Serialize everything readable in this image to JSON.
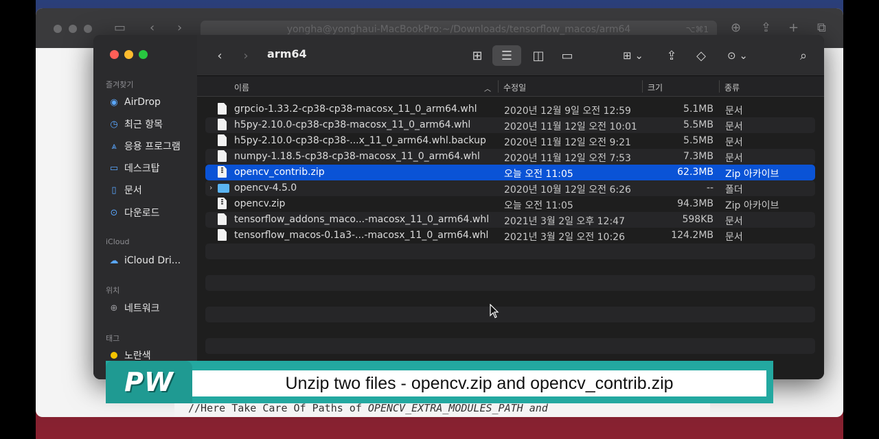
{
  "browser": {
    "url": "yongha@yonghaui-MacBookPro:~/Downloads/tensorflow_macos/arm64",
    "shortcut": "⌥⌘1"
  },
  "finder": {
    "title": "arm64",
    "sidebar": {
      "sections": [
        {
          "label": "즐겨찾기",
          "items": [
            {
              "label": "AirDrop",
              "icon": "airdrop-icon"
            },
            {
              "label": "최근 항목",
              "icon": "clock-icon"
            },
            {
              "label": "응용 프로그램",
              "icon": "applications-icon"
            },
            {
              "label": "데스크탑",
              "icon": "desktop-icon"
            },
            {
              "label": "문서",
              "icon": "document-icon"
            },
            {
              "label": "다운로드",
              "icon": "download-icon"
            }
          ]
        },
        {
          "label": "iCloud",
          "items": [
            {
              "label": "iCloud Dri...",
              "icon": "cloud-icon"
            }
          ]
        },
        {
          "label": "위치",
          "items": [
            {
              "label": "네트워크",
              "icon": "globe-icon"
            }
          ]
        },
        {
          "label": "태그",
          "items": [
            {
              "label": "노란색",
              "icon": "yellow-tag-icon"
            }
          ]
        }
      ]
    },
    "columns": {
      "name": "이름",
      "date": "수정일",
      "size": "크기",
      "kind": "종류"
    },
    "files": [
      {
        "name": "grpcio-1.33.2-cp38-cp38-macosx_11_0_arm64.whl",
        "date": "2020년 12월 9일 오전 12:59",
        "size": "5.1MB",
        "kind": "문서",
        "type": "doc"
      },
      {
        "name": "h5py-2.10.0-cp38-cp38-macosx_11_0_arm64.whl",
        "date": "2020년 11월 12일 오전 10:01",
        "size": "5.5MB",
        "kind": "문서",
        "type": "doc"
      },
      {
        "name": "h5py-2.10.0-cp38-cp38-...x_11_0_arm64.whl.backup",
        "date": "2020년 11월 12일 오전 9:21",
        "size": "5.5MB",
        "kind": "문서",
        "type": "doc"
      },
      {
        "name": "numpy-1.18.5-cp38-cp38-macosx_11_0_arm64.whl",
        "date": "2020년 11월 12일 오전 7:53",
        "size": "7.3MB",
        "kind": "문서",
        "type": "doc"
      },
      {
        "name": "opencv_contrib.zip",
        "date": "오늘 오전 11:05",
        "size": "62.3MB",
        "kind": "Zip 아카이브",
        "type": "zip",
        "selected": true
      },
      {
        "name": "opencv-4.5.0",
        "date": "2020년 10월 12일 오전 6:26",
        "size": "--",
        "kind": "폴더",
        "type": "folder"
      },
      {
        "name": "opencv.zip",
        "date": "오늘 오전 11:05",
        "size": "94.3MB",
        "kind": "Zip 아카이브",
        "type": "zip"
      },
      {
        "name": "tensorflow_addons_maco...-macosx_11_0_arm64.whl",
        "date": "2021년 3월 2일 오후 12:47",
        "size": "598KB",
        "kind": "문서",
        "type": "doc"
      },
      {
        "name": "tensorflow_macos-0.1a3-...-macosx_11_0_arm64.whl",
        "date": "2021년 3월 2일 오전 10:26",
        "size": "124.2MB",
        "kind": "문서",
        "type": "doc"
      }
    ]
  },
  "overlay": {
    "logo": "PW",
    "caption": "Unzip two files - opencv.zip and opencv_contrib.zip",
    "code_prefix": "//Here Take Care Of Paths of ",
    "code_italic": "OPENCV_EXTRA_MODULES_PATH and"
  },
  "colors": {
    "selection": "#0a53d6",
    "caption_teal": "#23a8a0",
    "folder": "#5ab4f2"
  }
}
